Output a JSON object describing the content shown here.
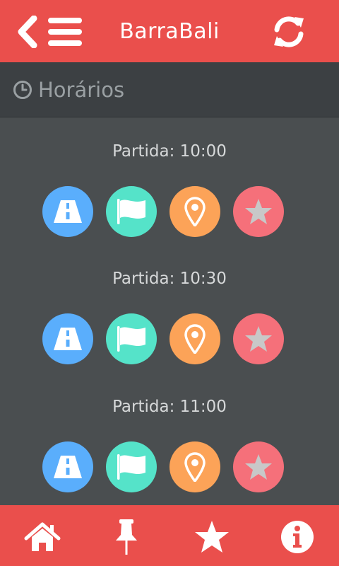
{
  "app": {
    "title": "BarraBali"
  },
  "header": {
    "back_menu_icon": "back-menu-icon",
    "refresh_icon": "refresh-icon"
  },
  "section": {
    "title": "Horários",
    "icon": "clock-icon"
  },
  "trips": [
    {
      "departure": "Partida: 10:00"
    },
    {
      "departure": "Partida: 10:30"
    },
    {
      "departure": "Partida: 11:00"
    }
  ],
  "trip_actions": [
    {
      "icon": "road-icon",
      "color": "#5aaefc"
    },
    {
      "icon": "flag-icon",
      "color": "#55e3c9"
    },
    {
      "icon": "map-pin-icon",
      "color": "#fca358"
    },
    {
      "icon": "star-icon",
      "color": "#f5707a"
    }
  ],
  "bottom_nav": [
    {
      "icon": "home-icon"
    },
    {
      "icon": "pin-icon"
    },
    {
      "icon": "star-icon"
    },
    {
      "icon": "info-icon"
    }
  ],
  "colors": {
    "primary": "#ea4f4c",
    "background": "#4a4e50",
    "section_header": "#3c4043"
  }
}
